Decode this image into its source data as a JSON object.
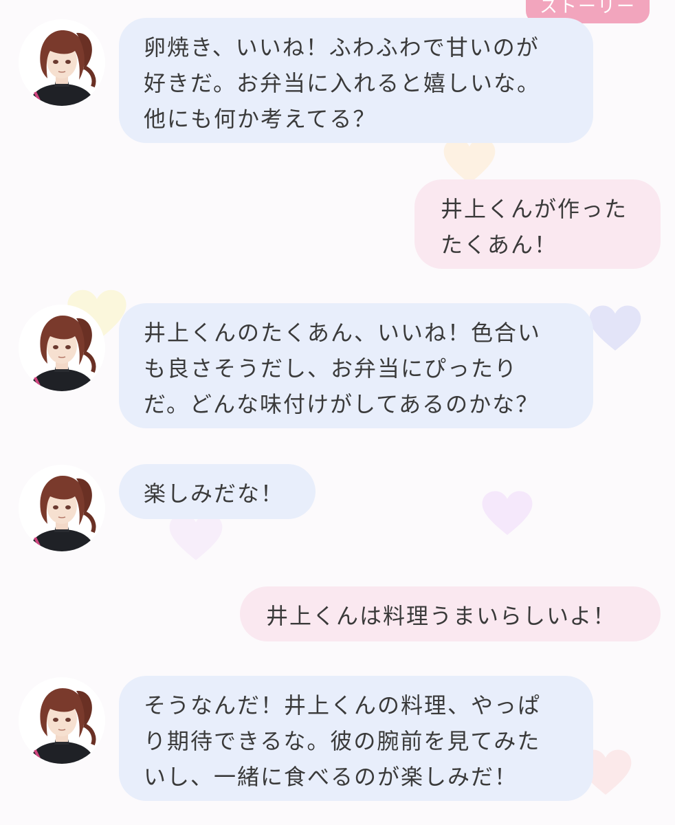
{
  "header": {
    "story_tab_label": "ストーリー"
  },
  "colors": {
    "background": "#fcfafc",
    "bubble_incoming": "#e8eefb",
    "bubble_outgoing": "#fae8f0",
    "story_tab": "#f2a5bd",
    "text": "#3a3a3a"
  },
  "icons": {
    "avatar": "character-avatar",
    "background_decoration": "heart-icon"
  },
  "messages": [
    {
      "sender": "character",
      "lines": [
        "卵焼き、いいね！ふわふわで甘いのが",
        "好きだ。お弁当に入れると嬉しいな。",
        "他にも何か考えてる？"
      ]
    },
    {
      "sender": "user",
      "lines": [
        "井上くんが作った",
        "たくあん！"
      ]
    },
    {
      "sender": "character",
      "lines": [
        "井上くんのたくあん、いいね！色合い",
        "も良さそうだし、お弁当にぴったり",
        "だ。どんな味付けがしてあるのかな？"
      ]
    },
    {
      "sender": "character",
      "lines": [
        "楽しみだな！"
      ]
    },
    {
      "sender": "user",
      "lines": [
        "井上くんは料理うまいらしいよ！"
      ]
    },
    {
      "sender": "character",
      "lines": [
        "そうなんだ！井上くんの料理、やっぱ",
        "り期待できるな。彼の腕前を見てみた",
        "いし、一緒に食べるのが楽しみだ！"
      ]
    }
  ]
}
